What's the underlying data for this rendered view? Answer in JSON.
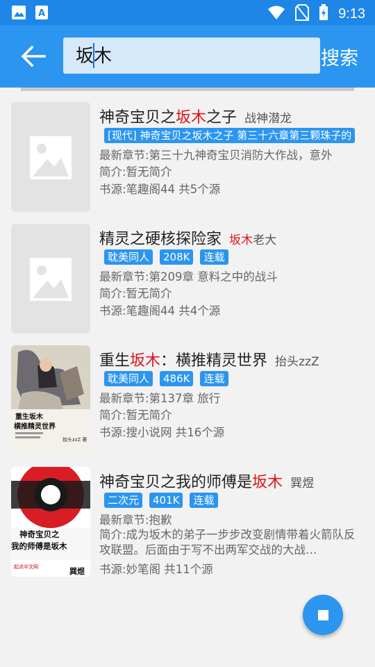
{
  "status_bar": {
    "time": "9:13",
    "icons": [
      "image-icon",
      "text-a-icon",
      "wifi-icon",
      "no-sim-icon",
      "battery-charging-icon"
    ]
  },
  "app_bar": {
    "back_icon": "arrow-left-icon",
    "search_value": "坂木",
    "search_button": "搜索"
  },
  "results": [
    {
      "title_pre": "神奇宝贝之",
      "title_hl": "坂木",
      "title_post": "之子",
      "author_pre": "战神潜龙",
      "author_hl": "",
      "author_post": "",
      "tags": [
        "[现代] 神奇宝贝之坂木之子 第三十六章第三颗珠子的"
      ],
      "latest": "最新章节:第三十九神奇宝贝消防大作战，意外",
      "intro": "简介:暂无简介",
      "source": "书源:笔趣阁44 共5个源",
      "cover": "placeholder-image-icon"
    },
    {
      "title_pre": "精灵之硬核探险家",
      "title_hl": "",
      "title_post": "",
      "author_pre": "",
      "author_hl": "坂木",
      "author_post": "老大",
      "tags": [
        "耽美同人",
        "208K",
        "连载"
      ],
      "latest": "最新章节:第209章 意料之中的战斗",
      "intro": "简介:暂无简介",
      "source": "书源:笔趣阁44 共4个源",
      "cover": "placeholder-image-icon"
    },
    {
      "title_pre": "重生",
      "title_hl": "坂木",
      "title_post": "：横推精灵世界",
      "author_pre": "抬头zzZ",
      "author_hl": "",
      "author_post": "",
      "tags": [
        "耽美同人",
        "486K",
        "连载"
      ],
      "latest": "最新章节:第137章 旅行",
      "intro": "简介:暂无简介",
      "source": "书源:搜小说网 共16个源",
      "cover": "book-cover-image"
    },
    {
      "title_pre": "神奇宝贝之我的师傅是",
      "title_hl": "坂木",
      "title_post": "",
      "author_pre": "巽煜",
      "author_hl": "",
      "author_post": "",
      "tags": [
        "二次元",
        "401K",
        "连载"
      ],
      "latest": "最新章节:抱歉",
      "intro": "简介:成为坂木的弟子一步步改变剧情带着火箭队反攻联盟。后面由于写不出两军交战的大战…",
      "source": "书源:妙笔阁 共11个源",
      "cover": "book-cover-image"
    }
  ],
  "covers": {
    "cover3_text": "重生坂木 横推精灵世界",
    "cover3_author": "抬头zzZ 著",
    "cover4_text": "神奇宝贝之我的师傅是坂木",
    "cover4_publisher": "起点中文网",
    "cover4_author": "巽煜"
  },
  "fab_icon": "stop-icon",
  "colors": {
    "status_bar": "#1e86e6",
    "app_bar": "#2b95ef",
    "search_box": "#d6e9fb",
    "highlight": "#e0141a",
    "tag": "#2b95ef"
  }
}
